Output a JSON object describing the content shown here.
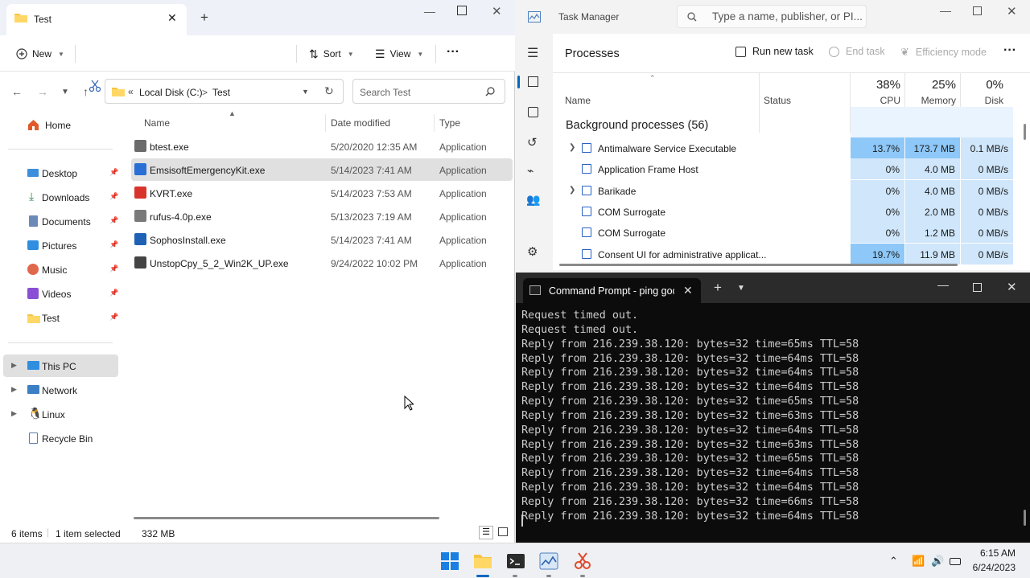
{
  "explorer": {
    "tab_title": "Test",
    "toolbar": {
      "new_label": "New",
      "sort_label": "Sort",
      "view_label": "View",
      "more_label": "···"
    },
    "address": {
      "chevrons": "«",
      "drive": "Local Disk (C:)",
      "sep": ">",
      "folder": "Test"
    },
    "search_placeholder": "Search Test",
    "nav": {
      "home": "Home",
      "pinned": [
        {
          "label": "Desktop",
          "icon": "desktop-icon"
        },
        {
          "label": "Downloads",
          "icon": "downloads-icon"
        },
        {
          "label": "Documents",
          "icon": "documents-icon"
        },
        {
          "label": "Pictures",
          "icon": "pictures-icon"
        },
        {
          "label": "Music",
          "icon": "music-icon"
        },
        {
          "label": "Videos",
          "icon": "videos-icon"
        },
        {
          "label": "Test",
          "icon": "folder-icon"
        }
      ],
      "drives": [
        {
          "label": "This PC",
          "icon": "pc-icon"
        },
        {
          "label": "Network",
          "icon": "network-icon"
        },
        {
          "label": "Linux",
          "icon": "linux-icon"
        },
        {
          "label": "Recycle Bin",
          "icon": "recycle-bin-icon"
        }
      ]
    },
    "columns": {
      "name": "Name",
      "date": "Date modified",
      "type": "Type"
    },
    "files": [
      {
        "name": "btest.exe",
        "date": "5/20/2020 12:35 AM",
        "type": "Application",
        "selected": false
      },
      {
        "name": "EmsisoftEmergencyKit.exe",
        "date": "5/14/2023 7:41 AM",
        "type": "Application",
        "selected": true
      },
      {
        "name": "KVRT.exe",
        "date": "5/14/2023 7:53 AM",
        "type": "Application",
        "selected": false
      },
      {
        "name": "rufus-4.0p.exe",
        "date": "5/13/2023 7:19 AM",
        "type": "Application",
        "selected": false
      },
      {
        "name": "SophosInstall.exe",
        "date": "5/14/2023 7:41 AM",
        "type": "Application",
        "selected": false
      },
      {
        "name": "UnstopCpy_5_2_Win2K_UP.exe",
        "date": "9/24/2022 10:02 PM",
        "type": "Application",
        "selected": false
      }
    ],
    "status": {
      "items": "6 items",
      "selected": "1 item selected",
      "size": "332 MB"
    }
  },
  "taskmanager": {
    "app_title": "Task Manager",
    "search_placeholder": "Type a name, publisher, or PI...",
    "page_title": "Processes",
    "run_new_task": "Run new task",
    "end_task": "End task",
    "efficiency_mode": "Efficiency mode",
    "columns": {
      "name": "Name",
      "status": "Status",
      "cpu_pct": "38%",
      "cpu": "CPU",
      "mem_pct": "25%",
      "mem": "Memory",
      "disk_pct": "0%",
      "disk": "Disk"
    },
    "group_title": "Background processes (56)",
    "processes": [
      {
        "name": "Antimalware Service Executable",
        "cpu": "13.7%",
        "mem": "173.7 MB",
        "disk": "0.1 MB/s",
        "expandable": true
      },
      {
        "name": "Application Frame Host",
        "cpu": "0%",
        "mem": "4.0 MB",
        "disk": "0 MB/s",
        "expandable": false
      },
      {
        "name": "Barikade",
        "cpu": "0%",
        "mem": "4.0 MB",
        "disk": "0 MB/s",
        "expandable": true
      },
      {
        "name": "COM Surrogate",
        "cpu": "0%",
        "mem": "2.0 MB",
        "disk": "0 MB/s",
        "expandable": false
      },
      {
        "name": "COM Surrogate",
        "cpu": "0%",
        "mem": "1.2 MB",
        "disk": "0 MB/s",
        "expandable": false
      },
      {
        "name": "Consent UI for administrative applicat...",
        "cpu": "19.7%",
        "mem": "11.9 MB",
        "disk": "0 MB/s",
        "expandable": false
      }
    ]
  },
  "cmd": {
    "tab_title": "Command Prompt - ping goc",
    "lines": [
      "Request timed out.",
      "Request timed out.",
      "Reply from 216.239.38.120: bytes=32 time=65ms TTL=58",
      "Reply from 216.239.38.120: bytes=32 time=64ms TTL=58",
      "Reply from 216.239.38.120: bytes=32 time=64ms TTL=58",
      "Reply from 216.239.38.120: bytes=32 time=64ms TTL=58",
      "Reply from 216.239.38.120: bytes=32 time=65ms TTL=58",
      "Reply from 216.239.38.120: bytes=32 time=63ms TTL=58",
      "Reply from 216.239.38.120: bytes=32 time=64ms TTL=58",
      "Reply from 216.239.38.120: bytes=32 time=63ms TTL=58",
      "Reply from 216.239.38.120: bytes=32 time=65ms TTL=58",
      "Reply from 216.239.38.120: bytes=32 time=64ms TTL=58",
      "Reply from 216.239.38.120: bytes=32 time=64ms TTL=58",
      "Reply from 216.239.38.120: bytes=32 time=66ms TTL=58",
      "Reply from 216.239.38.120: bytes=32 time=64ms TTL=58"
    ]
  },
  "taskbar": {
    "time": "6:15 AM",
    "date": "6/24/2023"
  },
  "colors": {
    "accent": "#0067c0",
    "selected_row": "#e0e0e0",
    "cpu_high": "#8ec8f8",
    "cpu_low": "#cfe6fb",
    "terminal_bg": "#0c0c0c"
  }
}
